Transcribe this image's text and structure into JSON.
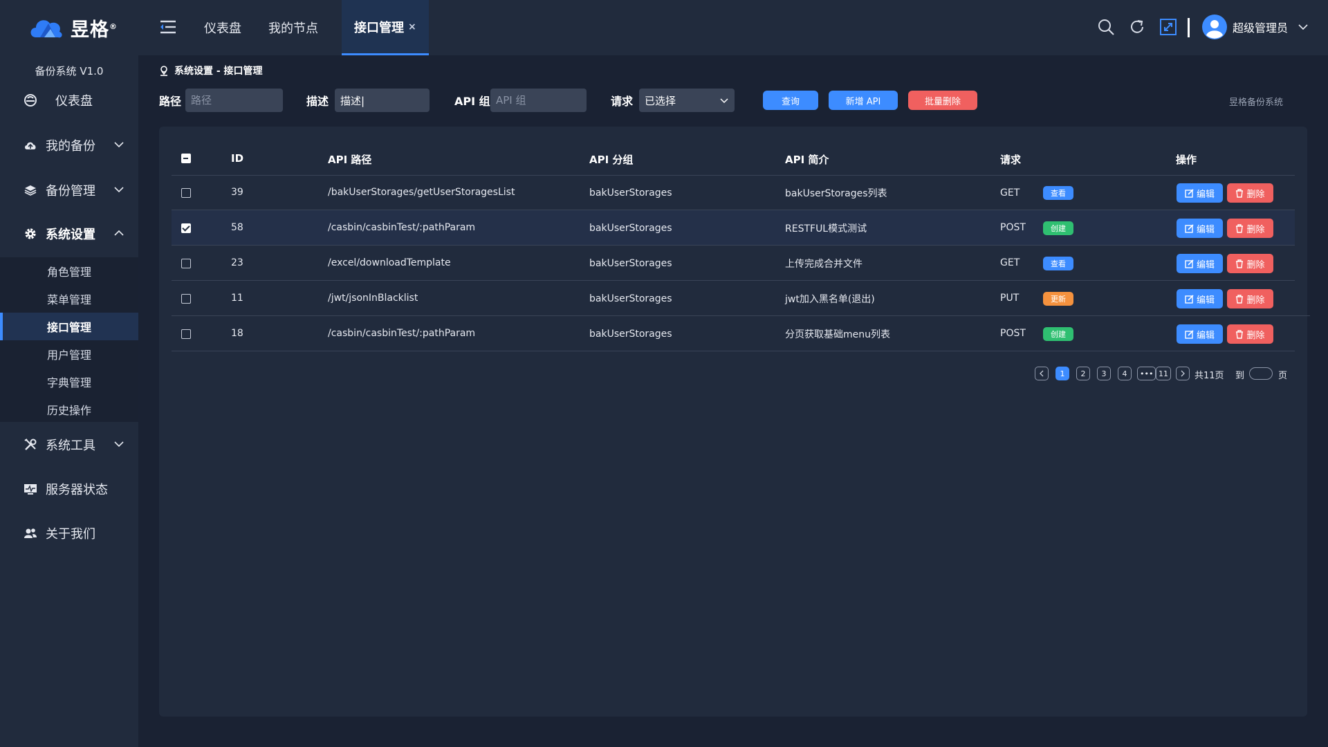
{
  "brand": {
    "name": "昱格",
    "mark": "®",
    "version": "备份系统 V1.0"
  },
  "sidebar": {
    "items": [
      {
        "label": "仪表盘",
        "icon": "dashboard-icon"
      },
      {
        "label": "我的备份",
        "icon": "cloud-icon"
      },
      {
        "label": "备份管理",
        "icon": "layers-icon"
      },
      {
        "label": "系统设置",
        "icon": "gear-icon"
      },
      {
        "label": "系统工具",
        "icon": "tools-icon"
      },
      {
        "label": "服务器状态",
        "icon": "monitor-icon"
      },
      {
        "label": "关于我们",
        "icon": "users-icon"
      }
    ],
    "submenu": [
      "角色管理",
      "菜单管理",
      "接口管理",
      "用户管理",
      "字典管理",
      "历史操作"
    ],
    "active_sub": "接口管理"
  },
  "header": {
    "tabs": [
      "仪表盘",
      "我的节点",
      "接口管理"
    ],
    "active_tab_close": "×",
    "user_name": "超级管理员"
  },
  "breadcrumb": "系统设置 - 接口管理",
  "filters": {
    "path_label": "路径",
    "path_placeholder": "路径",
    "desc_label": "描述",
    "desc_value": "描述|",
    "group_label": "API 组",
    "group_placeholder": "API 组",
    "method_label": "请求",
    "method_value": "已选择"
  },
  "buttons": {
    "query": "查询",
    "add": "新增 API",
    "batch_delete": "批量删除"
  },
  "system_name": "昱格备份系统",
  "table": {
    "headers": [
      "ID",
      "API 路径",
      "API 分组",
      "API 简介",
      "请求",
      "操作"
    ],
    "rows": [
      {
        "id": "39",
        "path": "/bakUserStorages/getUserStoragesList",
        "group": "bakUserStorages",
        "desc": "bakUserStorages列表",
        "method": "GET",
        "badge": "查看",
        "badge_color": "#3d8cff",
        "checked": false
      },
      {
        "id": "58",
        "path": "/casbin/casbinTest/:pathParam",
        "group": "bakUserStorages",
        "desc": "RESTFUL模式测试",
        "method": "POST",
        "badge": "创建",
        "badge_color": "#2fbf71",
        "checked": true
      },
      {
        "id": "23",
        "path": "/excel/downloadTemplate",
        "group": "bakUserStorages",
        "desc": "上传完成合并文件",
        "method": "GET",
        "badge": "查看",
        "badge_color": "#3d8cff",
        "checked": false
      },
      {
        "id": "11",
        "path": "/jwt/jsonInBlacklist",
        "group": "bakUserStorages",
        "desc": "jwt加入黑名单(退出)",
        "method": "PUT",
        "badge": "更新",
        "badge_color": "#f5923e",
        "checked": false
      },
      {
        "id": "18",
        "path": "/casbin/casbinTest/:pathParam",
        "group": "bakUserStorages",
        "desc": "分页获取基础menu列表",
        "method": "POST",
        "badge": "创建",
        "badge_color": "#2fbf71",
        "checked": false
      }
    ],
    "edit_label": "编辑",
    "delete_label": "删除"
  },
  "pagination": {
    "pages": [
      "1",
      "2",
      "3",
      "4",
      "•••",
      "11"
    ],
    "current": "1",
    "total": "共11页",
    "goto_label": "到",
    "page_suffix": "页"
  },
  "colors": {
    "accent": "#3d8cff",
    "danger": "#f0605f",
    "success": "#2fbf71",
    "warning": "#f5923e",
    "bg": "#1a2233",
    "panel": "#212b3d"
  }
}
